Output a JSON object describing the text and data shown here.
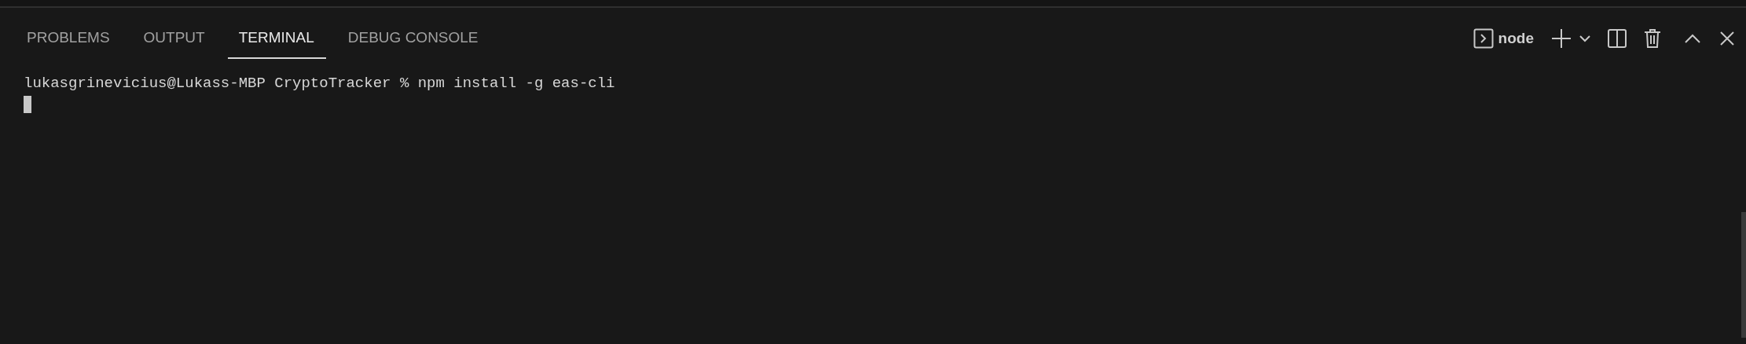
{
  "panel_tabs": [
    {
      "label": "PROBLEMS",
      "selected": false
    },
    {
      "label": "OUTPUT",
      "selected": false
    },
    {
      "label": "TERMINAL",
      "selected": true
    },
    {
      "label": "DEBUG CONSOLE",
      "selected": false
    }
  ],
  "toolbar": {
    "terminal_name": "node"
  },
  "terminal": {
    "lines": [
      "lukasgrinevicius@Lukass-MBP CryptoTracker % npm install -g eas-cli"
    ]
  }
}
